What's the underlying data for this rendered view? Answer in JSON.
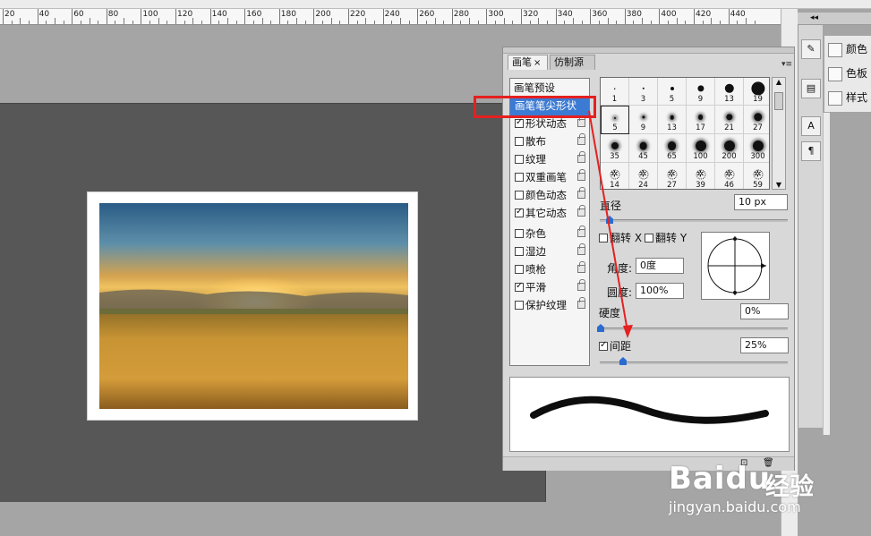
{
  "ruler": {
    "labels": [
      "20",
      "40",
      "60",
      "80",
      "100",
      "120",
      "140",
      "160",
      "180",
      "200",
      "220",
      "240",
      "260",
      "280",
      "300",
      "320",
      "340",
      "360",
      "380",
      "400",
      "420",
      "440"
    ]
  },
  "brush_panel": {
    "tabs": [
      {
        "label": "画笔"
      },
      {
        "label": "仿制源"
      }
    ],
    "header_item": "画笔预设",
    "items": [
      {
        "label": "画笔笔尖形状",
        "checkbox": false,
        "checked": false,
        "selected": true
      },
      {
        "label": "形状动态",
        "checkbox": true,
        "checked": true
      },
      {
        "label": "散布",
        "checkbox": true,
        "checked": false
      },
      {
        "label": "纹理",
        "checkbox": true,
        "checked": false
      },
      {
        "label": "双重画笔",
        "checkbox": true,
        "checked": false
      },
      {
        "label": "颜色动态",
        "checkbox": true,
        "checked": false
      },
      {
        "label": "其它动态",
        "checkbox": true,
        "checked": true
      },
      {
        "label": "杂色",
        "checkbox": true,
        "checked": false
      },
      {
        "label": "湿边",
        "checkbox": true,
        "checked": false
      },
      {
        "label": "喷枪",
        "checkbox": true,
        "checked": false
      },
      {
        "label": "平滑",
        "checkbox": true,
        "checked": true
      },
      {
        "label": "保护纹理",
        "checkbox": true,
        "checked": false
      }
    ],
    "tip_sizes": [
      "1",
      "3",
      "5",
      "9",
      "13",
      "19",
      "5",
      "9",
      "13",
      "17",
      "21",
      "27",
      "35",
      "45",
      "65",
      "100",
      "200",
      "300",
      "14",
      "24",
      "27",
      "39",
      "46",
      "59"
    ],
    "diameter_label": "直径",
    "diameter_value": "10 px",
    "flip_x_label": "翻转 X",
    "flip_y_label": "翻转 Y",
    "angle_label": "角度:",
    "angle_value": "0度",
    "roundness_label": "圆度:",
    "roundness_value": "100%",
    "hardness_label": "硬度",
    "hardness_value": "0%",
    "spacing_label": "间距",
    "spacing_value": "25%",
    "spacing_checked": true
  },
  "right_panel": {
    "items": [
      "颜色",
      "色板",
      "样式"
    ]
  },
  "watermark": {
    "brand": "Baidu",
    "brand_cn": "经验",
    "url": "jingyan.baidu.com"
  },
  "colors": {
    "selection_blue": "#3c7bd3",
    "annotation_red": "#e52020",
    "canvas_gray": "#575757"
  }
}
